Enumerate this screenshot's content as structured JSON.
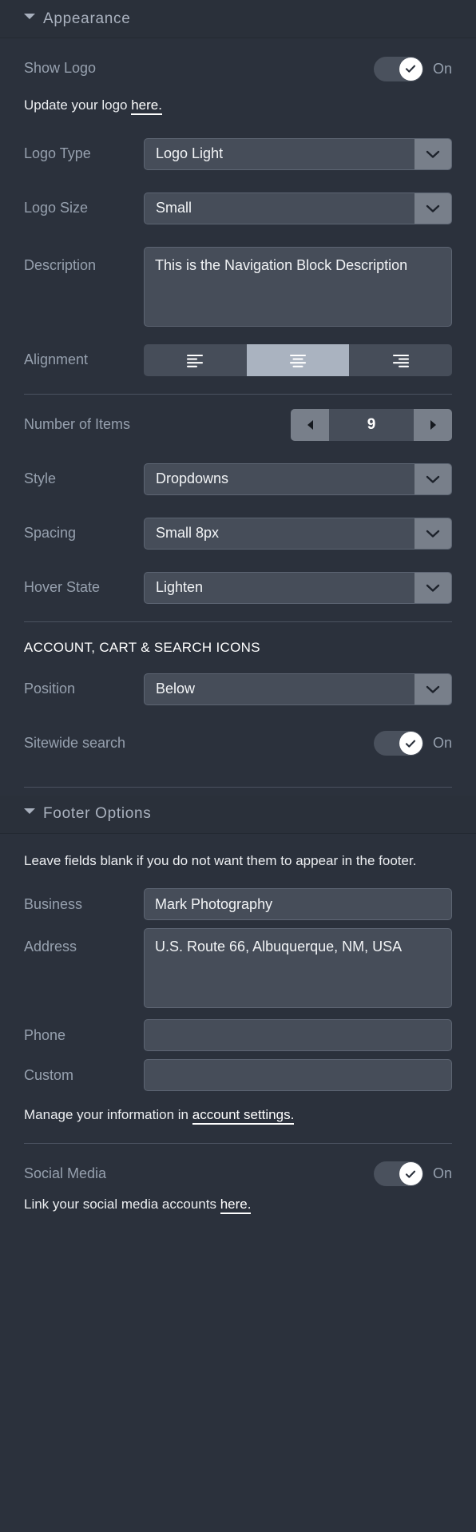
{
  "appearance_section": {
    "title": "Appearance",
    "caret_icon": "caret-down-icon",
    "show_logo": {
      "label": "Show Logo",
      "state": "On",
      "check_icon": "check-icon"
    },
    "logo_help": {
      "text_before": "Update your logo ",
      "link": "here."
    },
    "logo_type": {
      "label": "Logo Type",
      "value": "Logo Light",
      "arrow_icon": "chevron-down-icon"
    },
    "logo_size": {
      "label": "Logo Size",
      "value": "Small",
      "arrow_icon": "chevron-down-icon"
    },
    "description": {
      "label": "Description",
      "value": "This is the Navigation Block Description"
    },
    "alignment": {
      "label": "Alignment",
      "options": [
        {
          "name": "align-left-icon",
          "selected": false
        },
        {
          "name": "align-center-icon",
          "selected": true
        },
        {
          "name": "align-right-icon",
          "selected": false
        }
      ],
      "selected_index": 1
    },
    "number_of_items": {
      "label": "Number of Items",
      "value": "9",
      "decrement_icon": "triangle-left-icon",
      "increment_icon": "triangle-right-icon"
    },
    "style": {
      "label": "Style",
      "value": "Dropdowns",
      "arrow_icon": "chevron-down-icon"
    },
    "spacing": {
      "label": "Spacing",
      "value": "Small 8px",
      "arrow_icon": "chevron-down-icon"
    },
    "hover_state": {
      "label": "Hover State",
      "value": "Lighten",
      "arrow_icon": "chevron-down-icon"
    },
    "icons_subhead": "ACCOUNT, CART & SEARCH ICONS",
    "position": {
      "label": "Position",
      "value": "Below",
      "arrow_icon": "chevron-down-icon"
    },
    "sitewide_search": {
      "label": "Sitewide search",
      "state": "On",
      "check_icon": "check-icon"
    }
  },
  "footer_section": {
    "title": "Footer Options",
    "caret_icon": "caret-down-icon",
    "help": "Leave fields blank if you do not want them to appear in the footer.",
    "business": {
      "label": "Business",
      "value": "Mark Photography"
    },
    "address": {
      "label": "Address",
      "value": "U.S. Route 66, Albuquerque, NM, USA"
    },
    "phone": {
      "label": "Phone",
      "value": ""
    },
    "custom": {
      "label": "Custom",
      "value": ""
    },
    "manage_help": {
      "text_before": "Manage your information in ",
      "link": "account settings."
    },
    "social_media": {
      "label": "Social Media",
      "state": "On",
      "check_icon": "check-icon",
      "help_before": "Link your social media accounts ",
      "help_link": "here."
    }
  },
  "colors": {
    "panel_bg": "#2b313c",
    "header_bg": "#2a303a",
    "field_bg": "#464d59",
    "field_border": "#5d6573",
    "arrow_bg": "#787f8a",
    "label": "#96a0ae",
    "value": "#f2f4f6",
    "segment_active": "#aab3c0",
    "toggle_track": "#4a515d",
    "divider": "#4b5260"
  }
}
